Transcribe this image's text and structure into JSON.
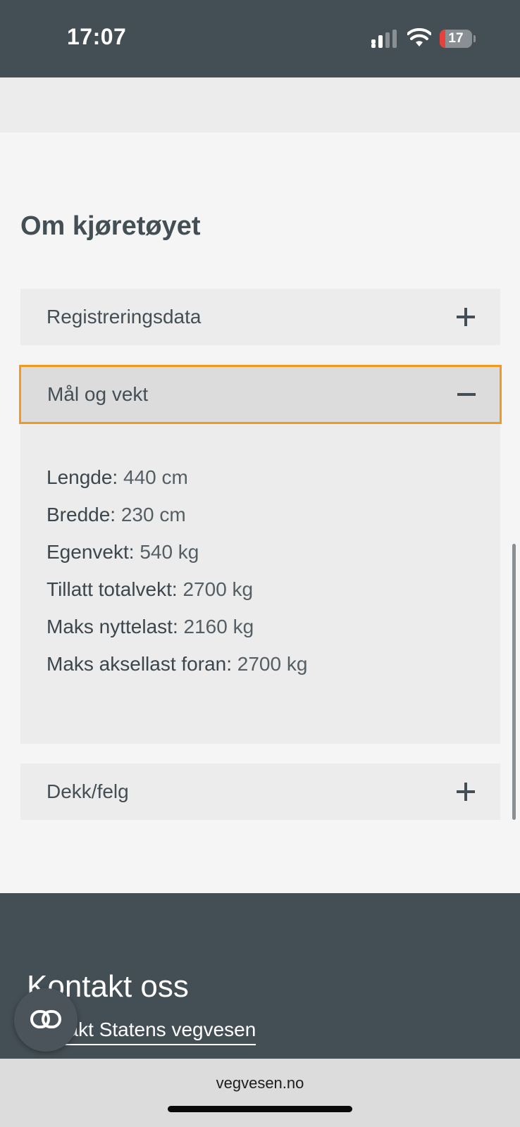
{
  "status_bar": {
    "time": "17:07",
    "battery_level": "17",
    "battery_fraction": 0.17,
    "icons": [
      "signal-icon",
      "wifi-icon",
      "battery-icon"
    ]
  },
  "section": {
    "title": "Om kjøretøyet"
  },
  "accordion": {
    "items": [
      {
        "label": "Registreringsdata",
        "expanded": false,
        "toggle_icon": "plus-icon"
      },
      {
        "label": "Mål og vekt",
        "expanded": true,
        "toggle_icon": "minus-icon"
      },
      {
        "label": "Dekk/felg",
        "expanded": false,
        "toggle_icon": "plus-icon"
      }
    ],
    "specs": [
      {
        "label": "Lengde:",
        "value": "440 cm"
      },
      {
        "label": "Bredde:",
        "value": "230 cm"
      },
      {
        "label": "Egenvekt:",
        "value": "540 kg"
      },
      {
        "label": "Tillatt totalvekt:",
        "value": "2700 kg"
      },
      {
        "label": "Maks nyttelast:",
        "value": "2160 kg"
      },
      {
        "label": "Maks aksellast foran:",
        "value": "2700 kg"
      }
    ]
  },
  "footer": {
    "title": "Kontakt oss",
    "link": "Kontakt Statens vegvesen",
    "fab_icon": "link-icon"
  },
  "browser": {
    "url": "vegvesen.no"
  },
  "colors": {
    "header": "#444f55",
    "focus_outline": "#f29a1f",
    "panel": "#ececec",
    "page": "#f5f5f5"
  }
}
